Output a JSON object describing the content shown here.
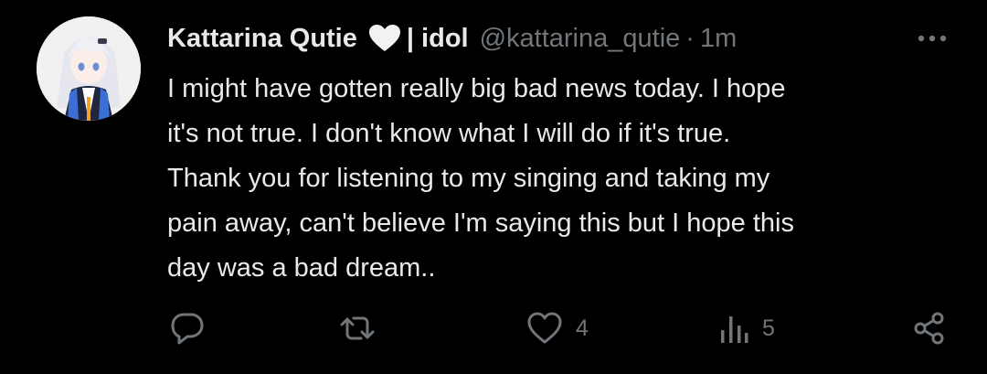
{
  "author": {
    "display_name": "Kattarina Qutie",
    "name_suffix": "| idol",
    "handle": "@kattarina_qutie",
    "separator": "·",
    "time_ago": "1m",
    "badge_icon": "white-heart-icon"
  },
  "tweet": {
    "text": "I might have gotten really big bad news today. I hope\nit's not true. I don't know what I will do if it's true.\nThank you for listening to my singing and taking my\npain away, can't believe I'm saying this but I hope this\nday was a bad dream.."
  },
  "actions": {
    "reply": {
      "icon": "reply-icon",
      "count": ""
    },
    "retweet": {
      "icon": "retweet-icon",
      "count": ""
    },
    "like": {
      "icon": "heart-icon",
      "count": "4"
    },
    "views": {
      "icon": "views-icon",
      "count": "5"
    },
    "share": {
      "icon": "share-icon"
    }
  },
  "colors": {
    "background": "#000000",
    "primary_text": "#e7e9ea",
    "secondary_text": "#71767b"
  }
}
